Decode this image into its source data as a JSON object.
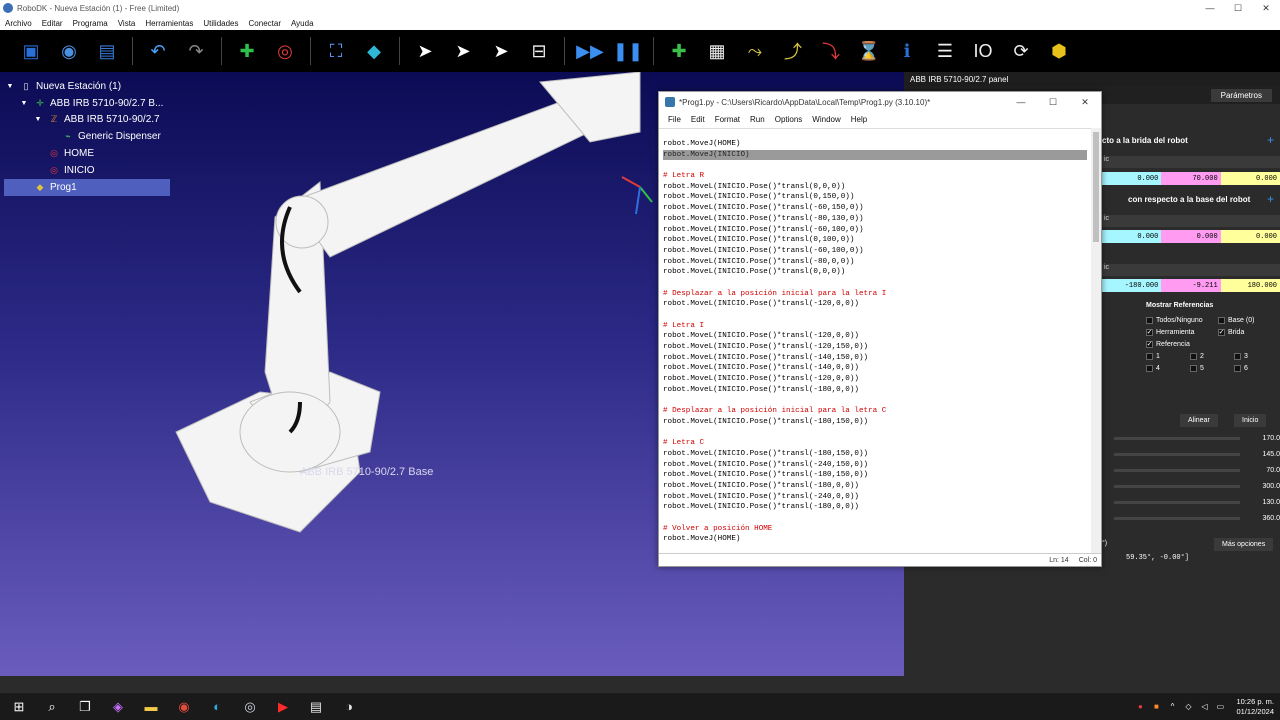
{
  "app": {
    "title": "RoboDK - Nueva Estación (1) - Free (Limited)",
    "controls": {
      "minimize": "—",
      "maximize": "☐",
      "close": "✕"
    }
  },
  "menu": [
    "Archivo",
    "Editar",
    "Programa",
    "Vista",
    "Herramientas",
    "Utilidades",
    "Conectar",
    "Ayuda"
  ],
  "toolbar": {
    "icons": [
      {
        "name": "open-station-icon",
        "glyph": "▣",
        "color": "#2a6fd6"
      },
      {
        "name": "web-library-icon",
        "glyph": "◉",
        "color": "#4b8fe0"
      },
      {
        "name": "save-icon",
        "glyph": "▤",
        "color": "#3a79d4"
      },
      {
        "name": "undo-icon",
        "glyph": "↶",
        "color": "#4aa3ff"
      },
      {
        "name": "redo-icon",
        "glyph": "↷",
        "color": "#888888"
      },
      {
        "name": "add-reference-icon",
        "glyph": "✚",
        "color": "#2fbf4a"
      },
      {
        "name": "add-target-icon",
        "glyph": "◎",
        "color": "#e23b3b"
      },
      {
        "name": "fit-all-icon",
        "glyph": "⛶",
        "color": "#5aa0ff"
      },
      {
        "name": "iso-view-icon",
        "glyph": "◆",
        "color": "#2fb8d6"
      },
      {
        "name": "select-icon",
        "glyph": "➤",
        "color": "#ffffff"
      },
      {
        "name": "move-reference-icon",
        "glyph": "➤",
        "color": "#ffffff"
      },
      {
        "name": "move-tool-icon",
        "glyph": "➤",
        "color": "#ffffff"
      },
      {
        "name": "collision-icon",
        "glyph": "⊟",
        "color": "#eeeeee"
      },
      {
        "name": "fast-forward-icon",
        "glyph": "▶▶",
        "color": "#3a8ff0"
      },
      {
        "name": "pause-icon",
        "glyph": "❚❚",
        "color": "#3a8ff0"
      },
      {
        "name": "python-program-icon",
        "glyph": "✚",
        "color": "#3bbf4a"
      },
      {
        "name": "add-program-icon",
        "glyph": "▦",
        "color": "#eeeeee"
      },
      {
        "name": "movej-icon",
        "glyph": "⤳",
        "color": "#d6c340"
      },
      {
        "name": "movel-icon",
        "glyph": "⤴",
        "color": "#d6c340"
      },
      {
        "name": "movec-icon",
        "glyph": "⤵",
        "color": "#e23b3b"
      },
      {
        "name": "pause-program-icon",
        "glyph": "⌛",
        "color": "#eeeeee"
      },
      {
        "name": "info-icon",
        "glyph": "ℹ",
        "color": "#2a6fd6"
      },
      {
        "name": "instruction-list-icon",
        "glyph": "☰",
        "color": "#eeeeee"
      },
      {
        "name": "io-icon",
        "glyph": "IO",
        "color": "#eeeeee"
      },
      {
        "name": "subprogram-icon",
        "glyph": "⟳",
        "color": "#eeeeee"
      },
      {
        "name": "package-icon",
        "glyph": "⬢",
        "color": "#e8c21a"
      }
    ]
  },
  "tree": [
    {
      "label": "Nueva Estación (1)",
      "indent": 0,
      "icon": "station-icon",
      "glyph": "▯",
      "color": "#dfe6f3",
      "expander": "▼"
    },
    {
      "label": "ABB IRB 5710-90/2.7 B...",
      "indent": 1,
      "icon": "robot-base-icon",
      "glyph": "✛",
      "color": "#3fbf4a",
      "expander": "▼"
    },
    {
      "label": "ABB IRB 5710-90/2.7",
      "indent": 2,
      "icon": "robot-icon",
      "glyph": "ℤ",
      "color": "#e0862b",
      "expander": "▼"
    },
    {
      "label": "Generic Dispenser",
      "indent": 3,
      "icon": "tool-icon",
      "glyph": "⌁",
      "color": "#4fcf5a",
      "expander": ""
    },
    {
      "label": "HOME",
      "indent": 2,
      "icon": "target-icon",
      "glyph": "◎",
      "color": "#e23b3b",
      "expander": ""
    },
    {
      "label": "INICIO",
      "indent": 2,
      "icon": "target-icon",
      "glyph": "◎",
      "color": "#e23b3b",
      "expander": ""
    },
    {
      "label": "Prog1",
      "indent": 1,
      "icon": "python-icon",
      "glyph": "◆",
      "color": "#e2c23b",
      "expander": "",
      "selected": true
    }
  ],
  "viewport": {
    "base_label": "ABB IRB 5710-90/2.7 Base"
  },
  "panel": {
    "title": "ABB IRB 5710-90/2.7 panel",
    "tab": "Parámetros",
    "section1": "cto a la brida del robot",
    "section2": "con respecto a la base del robot",
    "combo": "ic",
    "plus": "+",
    "row1": [
      "0.000",
      "70.000",
      "0.000"
    ],
    "row2": [
      "0.000",
      "0.000",
      "0.000"
    ],
    "row3": [
      "-180.000",
      "-9.211",
      "180.000"
    ],
    "refs_title": "Mostrar Referencias",
    "refs": [
      {
        "label": "Todos/Ninguno",
        "checked": false
      },
      {
        "label": "Base (0)",
        "checked": false
      },
      {
        "label": "Herramienta",
        "checked": true
      },
      {
        "label": "Brida",
        "checked": true
      },
      {
        "label": "Referencia",
        "checked": true
      }
    ],
    "ref_nums": [
      "1",
      "2",
      "3",
      "4",
      "5",
      "6"
    ],
    "align_btn": "Alinear",
    "home_btn": "Inicio",
    "joints": [
      "170.0",
      "145.0",
      "70.0",
      "300.0",
      "130.0",
      "360.0"
    ],
    "more_btn": "Más opciones",
    "bottom_left": "°)",
    "bottom_readout": "59.35°,   -0.00°]"
  },
  "editor": {
    "title": "*Prog1.py - C:\\Users\\Ricardo\\AppData\\Local\\Temp\\Prog1.py (3.10.10)*",
    "menu": [
      "File",
      "Edit",
      "Format",
      "Run",
      "Options",
      "Window",
      "Help"
    ],
    "lines": [
      {
        "t": "robot.MoveJ(HOME)",
        "k": "code"
      },
      {
        "t": "robot.MoveJ(INICIO)",
        "k": "hl"
      },
      {
        "t": "",
        "k": "code"
      },
      {
        "t": "# Letra R",
        "k": "cm"
      },
      {
        "t": "robot.MoveL(INICIO.Pose()*transl(0,0,0))",
        "k": "code"
      },
      {
        "t": "robot.MoveL(INICIO.Pose()*transl(0,150,0))",
        "k": "code"
      },
      {
        "t": "robot.MoveL(INICIO.Pose()*transl(-60,150,0))",
        "k": "code"
      },
      {
        "t": "robot.MoveL(INICIO.Pose()*transl(-80,130,0))",
        "k": "code"
      },
      {
        "t": "robot.MoveL(INICIO.Pose()*transl(-60,100,0))",
        "k": "code"
      },
      {
        "t": "robot.MoveL(INICIO.Pose()*transl(0,100,0))",
        "k": "code"
      },
      {
        "t": "robot.MoveL(INICIO.Pose()*transl(-60,100,0))",
        "k": "code"
      },
      {
        "t": "robot.MoveL(INICIO.Pose()*transl(-80,0,0))",
        "k": "code"
      },
      {
        "t": "robot.MoveL(INICIO.Pose()*transl(0,0,0))",
        "k": "code"
      },
      {
        "t": "",
        "k": "code"
      },
      {
        "t": "# Desplazar a la posición inicial para la letra I",
        "k": "cm"
      },
      {
        "t": "robot.MoveL(INICIO.Pose()*transl(-120,0,0))",
        "k": "code"
      },
      {
        "t": "",
        "k": "code"
      },
      {
        "t": "# Letra I",
        "k": "cm"
      },
      {
        "t": "robot.MoveL(INICIO.Pose()*transl(-120,0,0))",
        "k": "code"
      },
      {
        "t": "robot.MoveL(INICIO.Pose()*transl(-120,150,0))",
        "k": "code"
      },
      {
        "t": "robot.MoveL(INICIO.Pose()*transl(-140,150,0))",
        "k": "code"
      },
      {
        "t": "robot.MoveL(INICIO.Pose()*transl(-140,0,0))",
        "k": "code"
      },
      {
        "t": "robot.MoveL(INICIO.Pose()*transl(-120,0,0))",
        "k": "code"
      },
      {
        "t": "robot.MoveL(INICIO.Pose()*transl(-180,0,0))",
        "k": "code"
      },
      {
        "t": "",
        "k": "code"
      },
      {
        "t": "# Desplazar a la posición inicial para la letra C",
        "k": "cm"
      },
      {
        "t": "robot.MoveL(INICIO.Pose()*transl(-180,150,0))",
        "k": "code"
      },
      {
        "t": "",
        "k": "code"
      },
      {
        "t": "# Letra C",
        "k": "cm"
      },
      {
        "t": "robot.MoveL(INICIO.Pose()*transl(-180,150,0))",
        "k": "code"
      },
      {
        "t": "robot.MoveL(INICIO.Pose()*transl(-240,150,0))",
        "k": "code"
      },
      {
        "t": "robot.MoveL(INICIO.Pose()*transl(-180,150,0))",
        "k": "code"
      },
      {
        "t": "robot.MoveL(INICIO.Pose()*transl(-180,0,0))",
        "k": "code"
      },
      {
        "t": "robot.MoveL(INICIO.Pose()*transl(-240,0,0))",
        "k": "code"
      },
      {
        "t": "robot.MoveL(INICIO.Pose()*transl(-180,0,0))",
        "k": "code"
      },
      {
        "t": "",
        "k": "code"
      },
      {
        "t": "# Volver a posición HOME",
        "k": "cm"
      },
      {
        "t": "robot.MoveJ(HOME)",
        "k": "code"
      }
    ],
    "status_ln": "Ln: 14",
    "status_col": "Col: 0",
    "controls": {
      "minimize": "—",
      "maximize": "☐",
      "close": "✕"
    }
  },
  "taskbar": {
    "apps": [
      {
        "name": "windows-start-icon",
        "glyph": "⊞",
        "color": "#ffffff"
      },
      {
        "name": "search-icon",
        "glyph": "⌕",
        "color": "#ffffff"
      },
      {
        "name": "task-view-icon",
        "glyph": "❐",
        "color": "#ffffff"
      },
      {
        "name": "copilot-icon",
        "glyph": "◈",
        "color": "#c86fff"
      },
      {
        "name": "file-explorer-icon",
        "glyph": "▬",
        "color": "#f2c84b"
      },
      {
        "name": "chrome-icon",
        "glyph": "◉",
        "color": "#e34b3b"
      },
      {
        "name": "edge-icon",
        "glyph": "◐",
        "color": "#2fa8e0"
      },
      {
        "name": "browser-icon",
        "glyph": "◎",
        "color": "#cfd8e6"
      },
      {
        "name": "youtube-icon",
        "glyph": "▶",
        "color": "#ff2b2b"
      },
      {
        "name": "idle-python-icon",
        "glyph": "▤",
        "color": "#e8e8e8"
      },
      {
        "name": "robodk-icon",
        "glyph": "◑",
        "color": "#e8e8e8"
      }
    ],
    "time": "10:26 p. m.",
    "date": "01/12/2024"
  }
}
